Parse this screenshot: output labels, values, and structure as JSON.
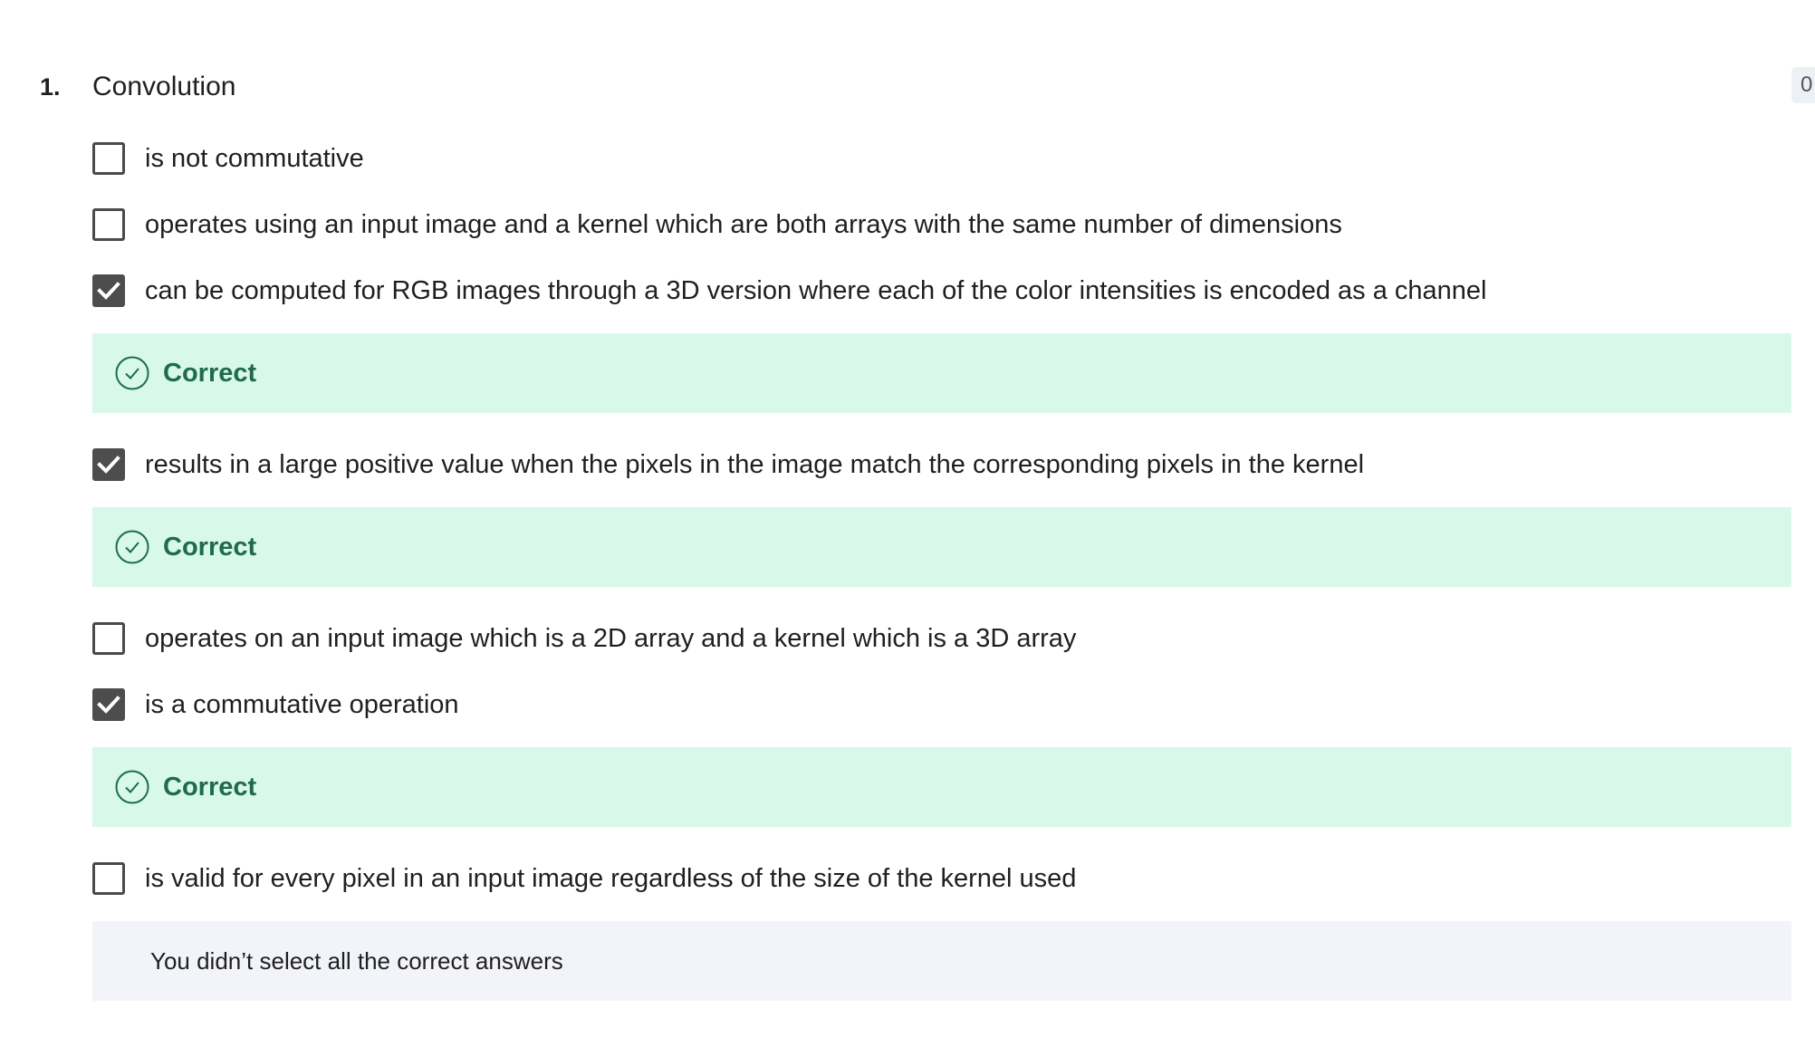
{
  "question": {
    "number": "1.",
    "title": "Convolution",
    "badge": "0"
  },
  "options": [
    {
      "label": "is not commutative",
      "checked": false
    },
    {
      "label": "operates using an input image and a kernel which are both arrays with the same number of dimensions",
      "checked": false
    },
    {
      "label": "can be computed for RGB images through a 3D version where each of the color intensities is encoded as a channel",
      "checked": true,
      "feedback": "Correct"
    },
    {
      "label": "results in a large positive value when the pixels in the image match the corresponding pixels in the kernel",
      "checked": true,
      "feedback": "Correct"
    },
    {
      "label": "operates on an input image which is a 2D array and a kernel which is a 3D array",
      "checked": false
    },
    {
      "label": "is a commutative operation",
      "checked": true,
      "feedback": "Correct"
    },
    {
      "label": "is valid for every pixel in an input image regardless of the size of the kernel used",
      "checked": false
    }
  ],
  "summary": "You didn’t select all the correct answers",
  "colors": {
    "correct_bg": "#d8f8ea",
    "correct_text": "#1f6b4b",
    "summary_bg": "#f3f4f9",
    "checkbox_checked": "#4d4d4d"
  },
  "icons": {
    "checked": "checkmark-icon",
    "feedback": "check-circle-icon"
  }
}
